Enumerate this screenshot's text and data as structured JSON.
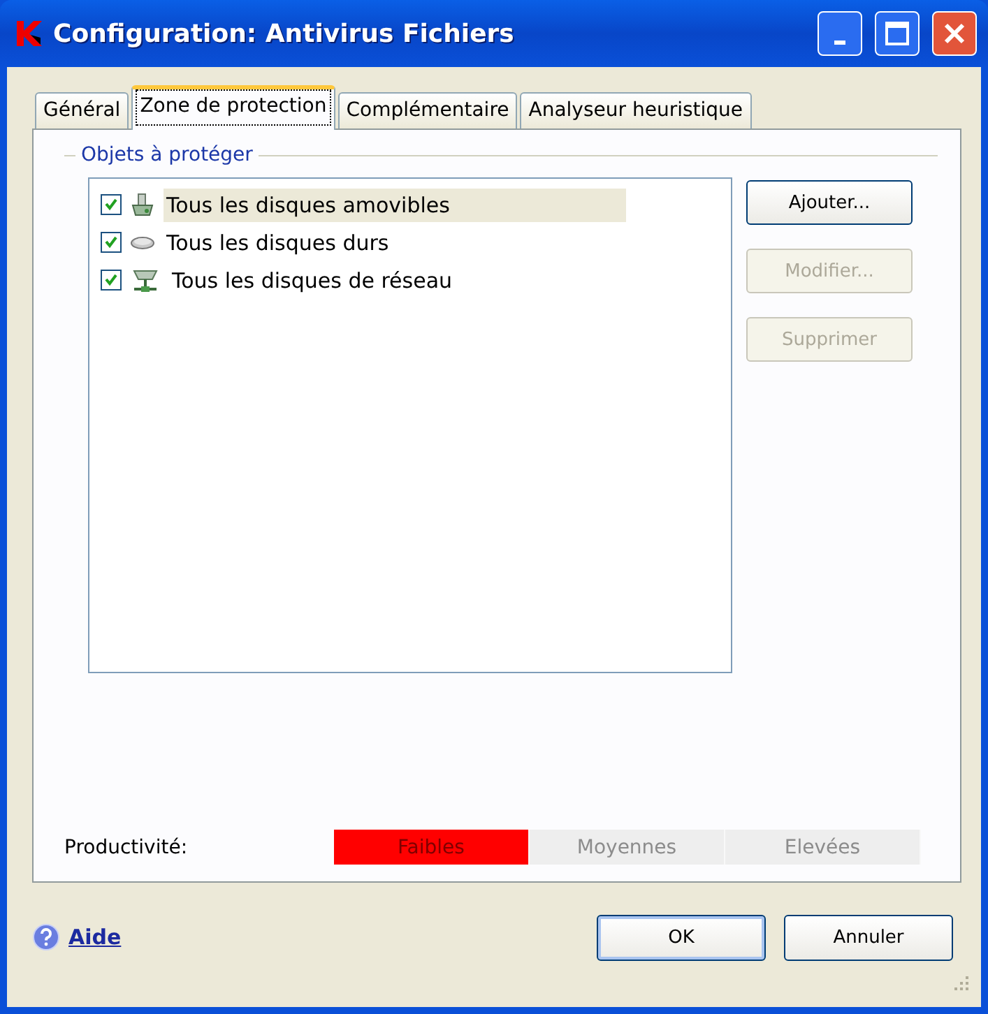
{
  "window": {
    "title": "Configuration: Antivirus Fichiers"
  },
  "tabs": [
    {
      "label": "Général",
      "selected": false
    },
    {
      "label": "Zone de protection",
      "selected": true
    },
    {
      "label": "Complémentaire",
      "selected": false
    },
    {
      "label": "Analyseur heuristique",
      "selected": false
    }
  ],
  "group": {
    "title": "Objets à protéger"
  },
  "objects": [
    {
      "label": "Tous les disques amovibles",
      "kind": "removable",
      "checked": true,
      "selected": true
    },
    {
      "label": "Tous les disques durs",
      "kind": "hard",
      "checked": true,
      "selected": false
    },
    {
      "label": "Tous les disques de réseau",
      "kind": "network",
      "checked": true,
      "selected": false
    }
  ],
  "side_buttons": [
    {
      "label": "Ajouter...",
      "disabled": false
    },
    {
      "label": "Modifier...",
      "disabled": true
    },
    {
      "label": "Supprimer",
      "disabled": true
    }
  ],
  "productivity": {
    "label": "Productivité:",
    "levels": [
      {
        "label": "Faibles",
        "selected": true
      },
      {
        "label": "Moyennes",
        "selected": false
      },
      {
        "label": "Elevées",
        "selected": false
      }
    ]
  },
  "help": {
    "label": "Aide"
  },
  "buttons": [
    {
      "label": "OK",
      "default": true
    },
    {
      "label": "Annuler",
      "default": false
    }
  ]
}
